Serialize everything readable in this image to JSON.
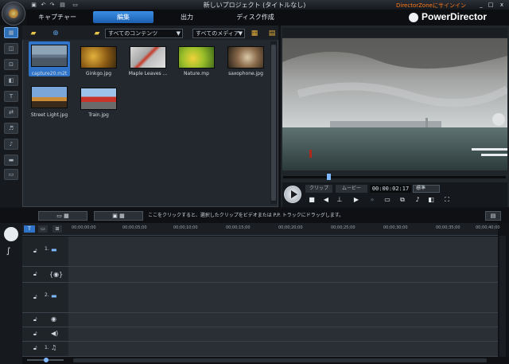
{
  "window": {
    "title": "新しいプロジェクト (タイトルなし)",
    "account_link": "DirectorZoneにサインイン",
    "minimize": "_",
    "restore": "□",
    "close": "x"
  },
  "tabs": [
    {
      "label": "キャプチャー"
    },
    {
      "label": "編集"
    },
    {
      "label": "出力"
    },
    {
      "label": "ディスク作成"
    }
  ],
  "brand": "PowerDirector",
  "library": {
    "filter_content": "すべてのコンテンツ",
    "filter_media": "すべてのメディア",
    "items": [
      {
        "name": "capture20.m2t"
      },
      {
        "name": "Ginkgo.jpg"
      },
      {
        "name": "Maple Leaves ..."
      },
      {
        "name": "Nature.mp"
      },
      {
        "name": "saxophone.jpg"
      },
      {
        "name": "Street Light.jpg"
      },
      {
        "name": "Train.jpg"
      }
    ]
  },
  "preview": {
    "mode_clip": "クリップ",
    "mode_movie": "ムービー",
    "timecode": "00:00:02:17",
    "quality": "標準"
  },
  "timeline": {
    "hint": "ここをクリックすると、選択したクリップをビデオまたは P.P. トラックにドラッグします。",
    "ruler": [
      "00;00;00;00",
      "00;00;05;00",
      "00;00;10;00",
      "00;00;15;00",
      "00;00;20;00",
      "00;00;25;00",
      "00;00;30;00",
      "00;00;35;00",
      "00;00;40;00"
    ],
    "tracks": [
      {
        "label": "1."
      },
      {
        "label": ""
      },
      {
        "label": "2."
      },
      {
        "label": ""
      },
      {
        "label": ""
      },
      {
        "label": "1."
      }
    ]
  }
}
